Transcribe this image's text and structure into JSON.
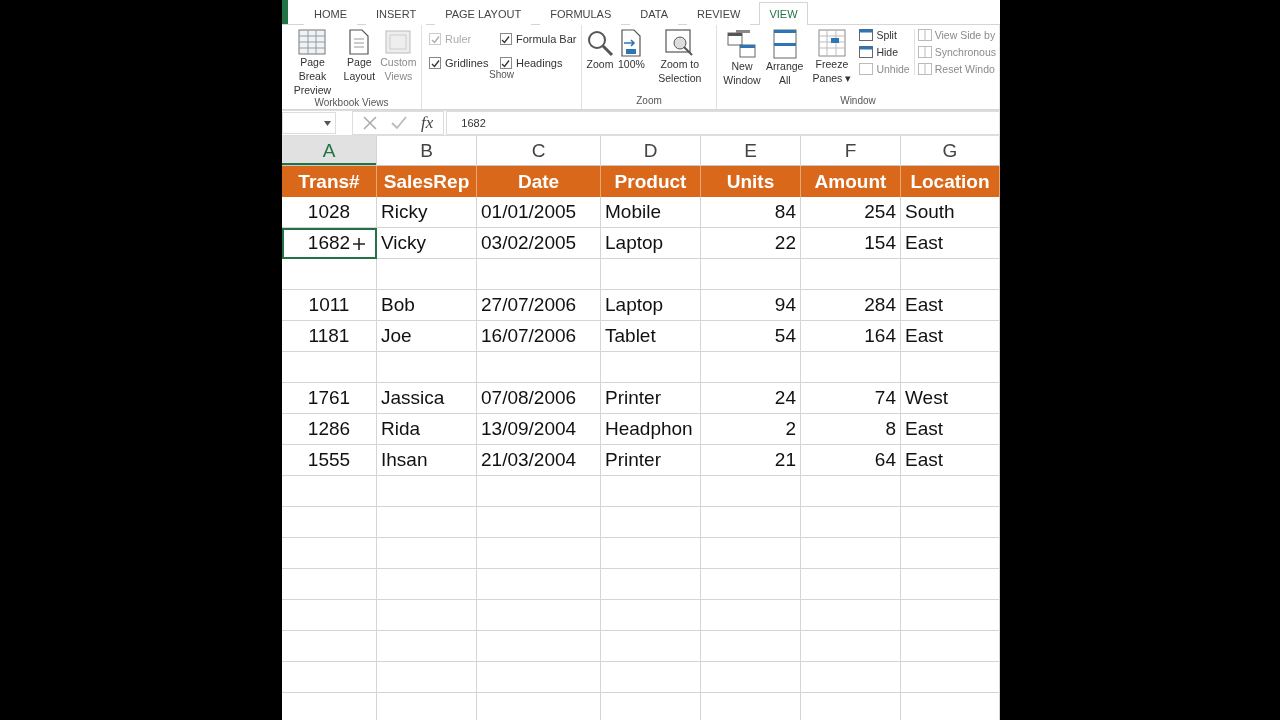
{
  "ribbon": {
    "tabs": [
      {
        "label": "HOME",
        "selected": false
      },
      {
        "label": "INSERT",
        "selected": false
      },
      {
        "label": "PAGE LAYOUT",
        "selected": false
      },
      {
        "label": "FORMULAS",
        "selected": false
      },
      {
        "label": "DATA",
        "selected": false
      },
      {
        "label": "REVIEW",
        "selected": false
      },
      {
        "label": "VIEW",
        "selected": true
      }
    ],
    "groups": [
      {
        "label": "Workbook Views",
        "kind": "buttons",
        "items": [
          {
            "label": "Page Break Preview",
            "disabled": false
          },
          {
            "label": "Page Layout",
            "disabled": false
          },
          {
            "label": "Custom Views",
            "disabled": true
          }
        ]
      },
      {
        "label": "Show",
        "kind": "checks",
        "items": [
          {
            "label": "Ruler",
            "checked": true,
            "disabled": true
          },
          {
            "label": "Formula Bar",
            "checked": true,
            "disabled": false
          },
          {
            "label": "Gridlines",
            "checked": true,
            "disabled": false
          },
          {
            "label": "Headings",
            "checked": true,
            "disabled": false
          }
        ]
      },
      {
        "label": "Zoom",
        "kind": "buttons",
        "items": [
          {
            "label": "Zoom",
            "disabled": false
          },
          {
            "label": "100%",
            "disabled": false
          },
          {
            "label": "Zoom to Selection",
            "disabled": false
          }
        ]
      },
      {
        "label": "Window",
        "kind": "window",
        "items": [
          {
            "label": "New Window",
            "disabled": false
          },
          {
            "label": "Arrange All",
            "disabled": false
          },
          {
            "label": "Freeze Panes",
            "disabled": false,
            "dropdown": "▾"
          }
        ],
        "small_items": [
          {
            "label": "Split",
            "disabled": false
          },
          {
            "label": "Hide",
            "disabled": false
          },
          {
            "label": "Unhide",
            "disabled": true
          }
        ],
        "side_items": [
          {
            "label": "View Side by",
            "disabled": true
          },
          {
            "label": "Synchronous",
            "disabled": true
          },
          {
            "label": "Reset Windo",
            "disabled": true
          }
        ]
      }
    ]
  },
  "formula_bar": {
    "function_label": "fx",
    "value": "1682"
  },
  "sheet": {
    "columns": [
      {
        "letter": "A",
        "selected": true
      },
      {
        "letter": "B",
        "selected": false
      },
      {
        "letter": "C",
        "selected": false
      },
      {
        "letter": "D",
        "selected": false
      },
      {
        "letter": "E",
        "selected": false
      },
      {
        "letter": "F",
        "selected": false
      },
      {
        "letter": "G",
        "selected": false
      }
    ],
    "header": [
      "Trans#",
      "SalesRep",
      "Date",
      "Product",
      "Units",
      "Amount",
      "Location"
    ],
    "rows": [
      {
        "kind": "data",
        "cells": [
          "1028",
          "Ricky",
          "01/01/2005",
          "Mobile",
          "84",
          "254",
          "South"
        ]
      },
      {
        "kind": "data",
        "cells": [
          "1682",
          "Vicky",
          "03/02/2005",
          "Laptop",
          "22",
          "154",
          "East"
        ],
        "selected_cells": [
          true,
          false,
          false,
          false,
          false,
          false,
          false
        ]
      },
      {
        "kind": "blank"
      },
      {
        "kind": "data",
        "cells": [
          "1011",
          "Bob",
          "27/07/2006",
          "Laptop",
          "94",
          "284",
          "East"
        ]
      },
      {
        "kind": "data",
        "cells": [
          "1181",
          "Joe",
          "16/07/2006",
          "Tablet",
          "54",
          "164",
          "East"
        ]
      },
      {
        "kind": "blank"
      },
      {
        "kind": "data",
        "cells": [
          "1761",
          "Jassica",
          "07/08/2006",
          "Printer",
          "24",
          "74",
          "West"
        ]
      },
      {
        "kind": "data",
        "cells": [
          "1286",
          "Rida",
          "13/09/2004",
          "Headphon",
          "2",
          "8",
          "East"
        ]
      },
      {
        "kind": "data",
        "cells": [
          "1555",
          "Ihsan",
          "21/03/2004",
          "Printer",
          "21",
          "64",
          "East"
        ]
      }
    ]
  }
}
